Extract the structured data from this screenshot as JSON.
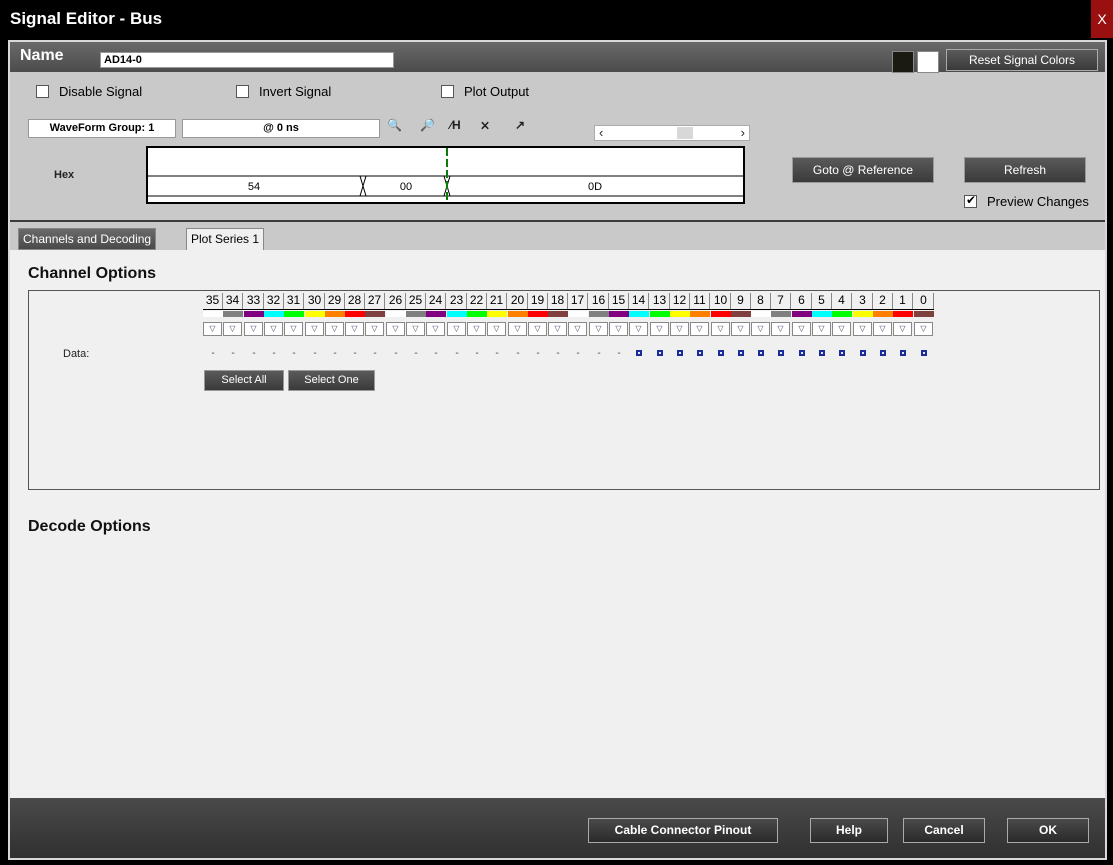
{
  "window": {
    "title": "Signal Editor - Bus",
    "close_label": "X"
  },
  "name_bar": {
    "label": "Name",
    "value": "AD14-0",
    "swatch_colors": [
      "#1a1a12",
      "#ffffff"
    ],
    "reset_label": "Reset Signal Colors"
  },
  "options": {
    "disable_signal": {
      "label": "Disable Signal",
      "checked": false
    },
    "invert_signal": {
      "label": "Invert Signal",
      "checked": false
    },
    "plot_output": {
      "label": "Plot Output",
      "checked": false
    }
  },
  "toolbar": {
    "waveform_group": "WaveForm Group: 1",
    "time": "@ 0 ns",
    "icons": [
      "zoom-trigger-icon",
      "zoom-in-out-icon",
      "marker-to-h-icon",
      "swap-markers-icon",
      "marker-forward-icon"
    ]
  },
  "waveform": {
    "radix_label": "Hex",
    "segments": [
      "54",
      "00",
      "0D"
    ]
  },
  "buttons": {
    "goto_reference": "Goto @ Reference",
    "refresh": "Refresh",
    "preview_changes": {
      "label": "Preview Changes",
      "checked": true
    }
  },
  "tabs": [
    {
      "label": "Channels and Decoding",
      "active": true
    },
    {
      "label": "Plot Series 1",
      "active": false
    }
  ],
  "channel_options": {
    "title": "Channel Options",
    "channels": [
      "35",
      "34",
      "33",
      "32",
      "31",
      "30",
      "29",
      "28",
      "27",
      "26",
      "25",
      "24",
      "23",
      "22",
      "21",
      "20",
      "19",
      "18",
      "17",
      "16",
      "15",
      "14",
      "13",
      "12",
      "11",
      "10",
      "9",
      "8",
      "7",
      "6",
      "5",
      "4",
      "3",
      "2",
      "1",
      "0"
    ],
    "channel_colors": [
      "#ffffff",
      "#808080",
      "#800080",
      "#00ffff",
      "#00ff00",
      "#ffff00",
      "#ff8000",
      "#ff0000",
      "#804040",
      "#ffffff",
      "#808080",
      "#800080",
      "#00ffff",
      "#00ff00",
      "#ffff00",
      "#ff8000",
      "#ff0000",
      "#804040",
      "#ffffff",
      "#808080",
      "#800080",
      "#00ffff",
      "#00ff00",
      "#ffff00",
      "#ff8000",
      "#ff0000",
      "#804040",
      "#ffffff",
      "#808080",
      "#800080",
      "#00ffff",
      "#00ff00",
      "#ffff00",
      "#ff8000",
      "#ff0000",
      "#804040"
    ],
    "data_label": "Data:",
    "data_dash": "-",
    "active_count": 15,
    "select_all": "Select All",
    "select_one": "Select One"
  },
  "decode_options": {
    "title": "Decode Options"
  },
  "footer": {
    "cable_pinout": "Cable Connector Pinout",
    "help": "Help",
    "cancel": "Cancel",
    "ok": "OK"
  }
}
